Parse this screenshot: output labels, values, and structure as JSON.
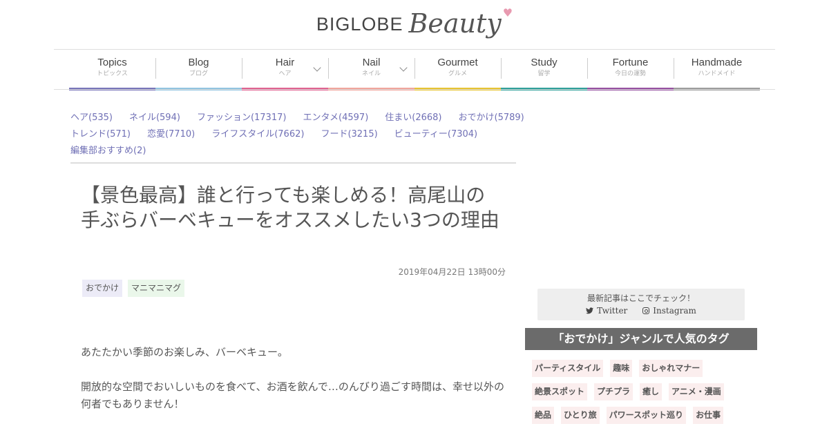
{
  "logo": {
    "brand": "BIGLOBE",
    "product": "Beauty",
    "heart": "♥"
  },
  "nav": [
    {
      "en": "Topics",
      "jp": "トピックス",
      "color": "#7471b7",
      "has_dropdown": false
    },
    {
      "en": "Blog",
      "jp": "ブログ",
      "color": "#8fc3e0",
      "has_dropdown": false
    },
    {
      "en": "Hair",
      "jp": "ヘア",
      "color": "#df5e8d",
      "has_dropdown": true
    },
    {
      "en": "Nail",
      "jp": "ネイル",
      "color": "#f0a39a",
      "has_dropdown": true
    },
    {
      "en": "Gourmet",
      "jp": "グルメ",
      "color": "#e6c22c",
      "has_dropdown": false
    },
    {
      "en": "Study",
      "jp": "留学",
      "color": "#2a9d97",
      "has_dropdown": false
    },
    {
      "en": "Fortune",
      "jp": "今日の運勢",
      "color": "#934c9e",
      "has_dropdown": false
    },
    {
      "en": "Handmade",
      "jp": "ハンドメイド",
      "color": "#9a9a9a",
      "has_dropdown": false
    }
  ],
  "categories": [
    [
      "ヘア(535)",
      "ネイル(594)",
      "ファッション(17317)",
      "エンタメ(4597)",
      "住まい(2668)",
      "おでかけ(5789)"
    ],
    [
      "トレンド(571)",
      "恋愛(7710)",
      "ライフスタイル(7662)",
      "フード(3215)",
      "ビューティー(7304)"
    ],
    [
      "編集部おすすめ(2)"
    ]
  ],
  "article": {
    "title": "【景色最高】誰と行っても楽しめる！高尾山の手ぶらバーベキューをオススメしたい3つの理由",
    "date": "2019年04月22日 13時00分",
    "tags": [
      "おでかけ",
      "マニマニマグ"
    ],
    "paragraphs": [
      "あたたかい季節のお楽しみ、バーベキュー。",
      "開放的な空間でおいしいものを食べて、お酒を飲んで…のんびり過ごす時間は、幸せ以外の何者でもありません！"
    ]
  },
  "sidebar": {
    "social_title": "最新記事はここでチェック！",
    "twitter": "Twitter",
    "instagram": "Instagram",
    "genre_heading": "「おでかけ」ジャンルで人気のタグ",
    "popular_tags": [
      [
        "パーティスタイル",
        "趣味",
        "おしゃれマナー"
      ],
      [
        "絶景スポット",
        "プチプラ",
        "癒し",
        "アニメ・漫画"
      ],
      [
        "絶品",
        "ひとり旅",
        "パワースポット巡り",
        "お仕事"
      ]
    ]
  }
}
